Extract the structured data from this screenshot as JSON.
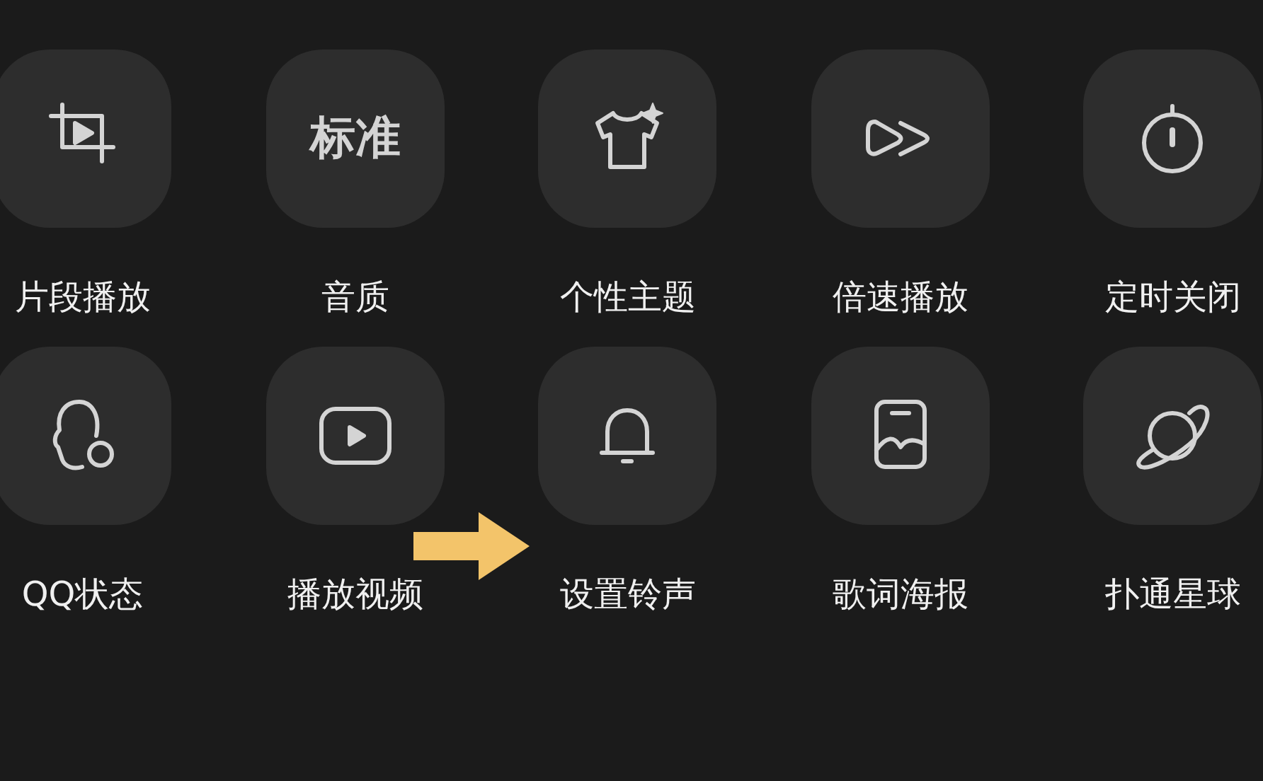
{
  "items": [
    {
      "label": "片段播放"
    },
    {
      "label": "音质",
      "tile_text": "标准"
    },
    {
      "label": "个性主题"
    },
    {
      "label": "倍速播放"
    },
    {
      "label": "定时关闭"
    },
    {
      "label": "QQ状态"
    },
    {
      "label": "播放视频"
    },
    {
      "label": "设置铃声"
    },
    {
      "label": "歌词海报"
    },
    {
      "label": "扑通星球"
    }
  ]
}
